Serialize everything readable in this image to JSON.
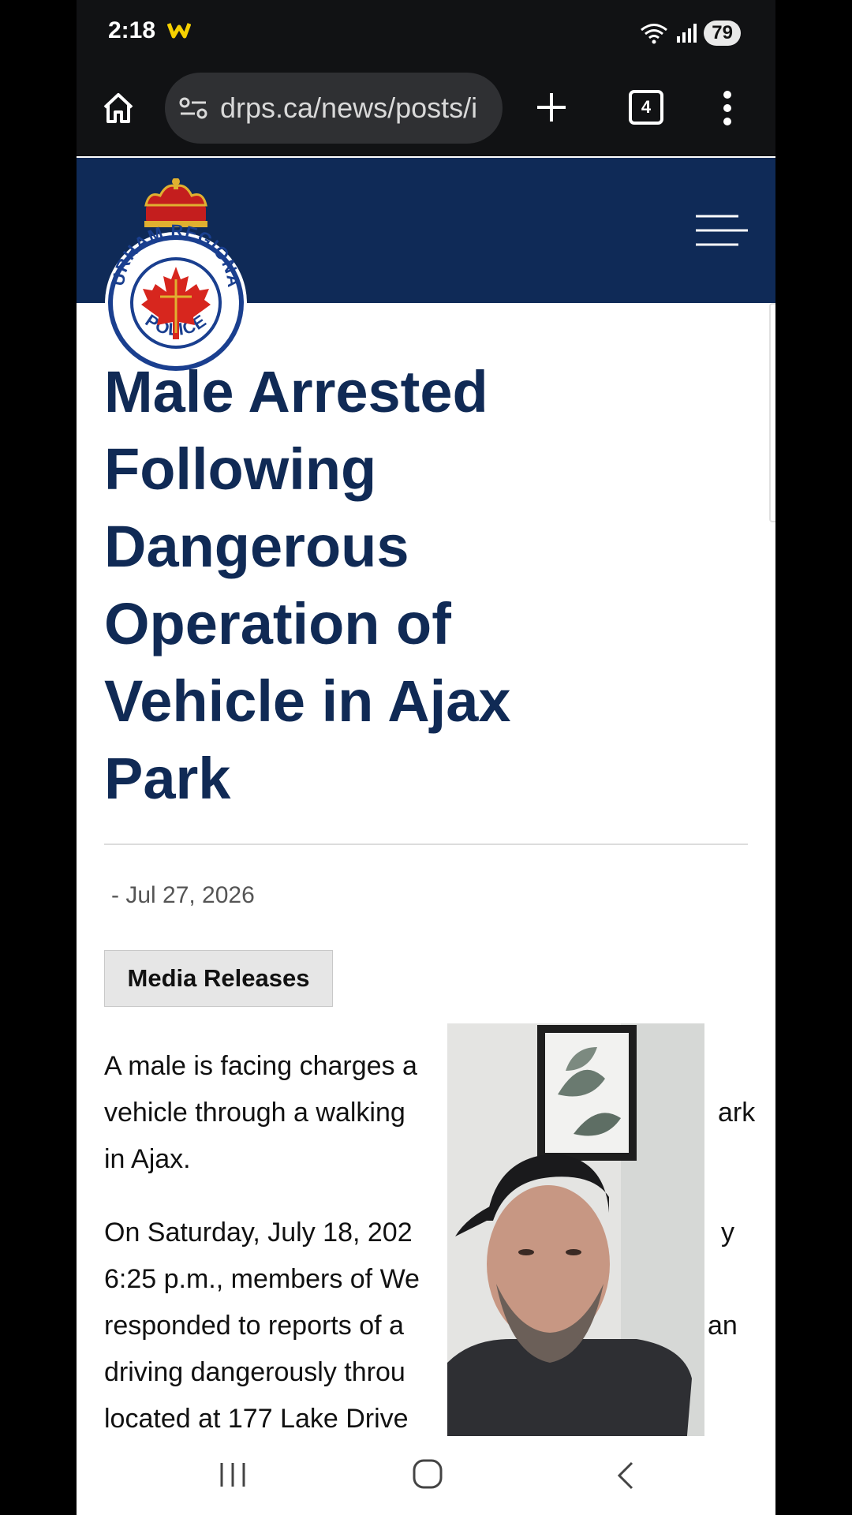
{
  "status_bar": {
    "time": "2:18",
    "battery": "79",
    "icons": [
      "w-app-icon",
      "wifi-icon",
      "signal-icon",
      "battery-icon"
    ]
  },
  "browser": {
    "url": "drps.ca/news/posts/i",
    "tab_count": "4",
    "icons": [
      "home-icon",
      "site-settings-icon",
      "new-tab-icon",
      "tabs-icon",
      "more-vert-icon"
    ]
  },
  "site": {
    "logo_text_top": "DURHAM REGIONAL",
    "logo_text_bottom": "POLICE",
    "header_color": "#0f2a57",
    "accent_color": "#102a55"
  },
  "article": {
    "title": "Male Arrested Following Dangerous Operation of Vehicle in Ajax Park",
    "date": "- Jul 27, 2026",
    "category": "Media Releases",
    "paragraph1_lines": [
      "A male is facing charges a",
      "vehicle through a walking",
      "in Ajax."
    ],
    "paragraph1_tail": "ark",
    "paragraph2_lines": [
      "On Saturday, July 18, 202",
      "6:25 p.m., members of We",
      "responded to reports of a",
      "driving dangerously throu",
      "located at 177 Lake Drive"
    ],
    "paragraph2_tails": [
      "y",
      "",
      "an",
      "",
      ""
    ]
  },
  "nav_bar": {
    "icons": [
      "recents-icon",
      "home-circle-icon",
      "back-icon"
    ]
  }
}
